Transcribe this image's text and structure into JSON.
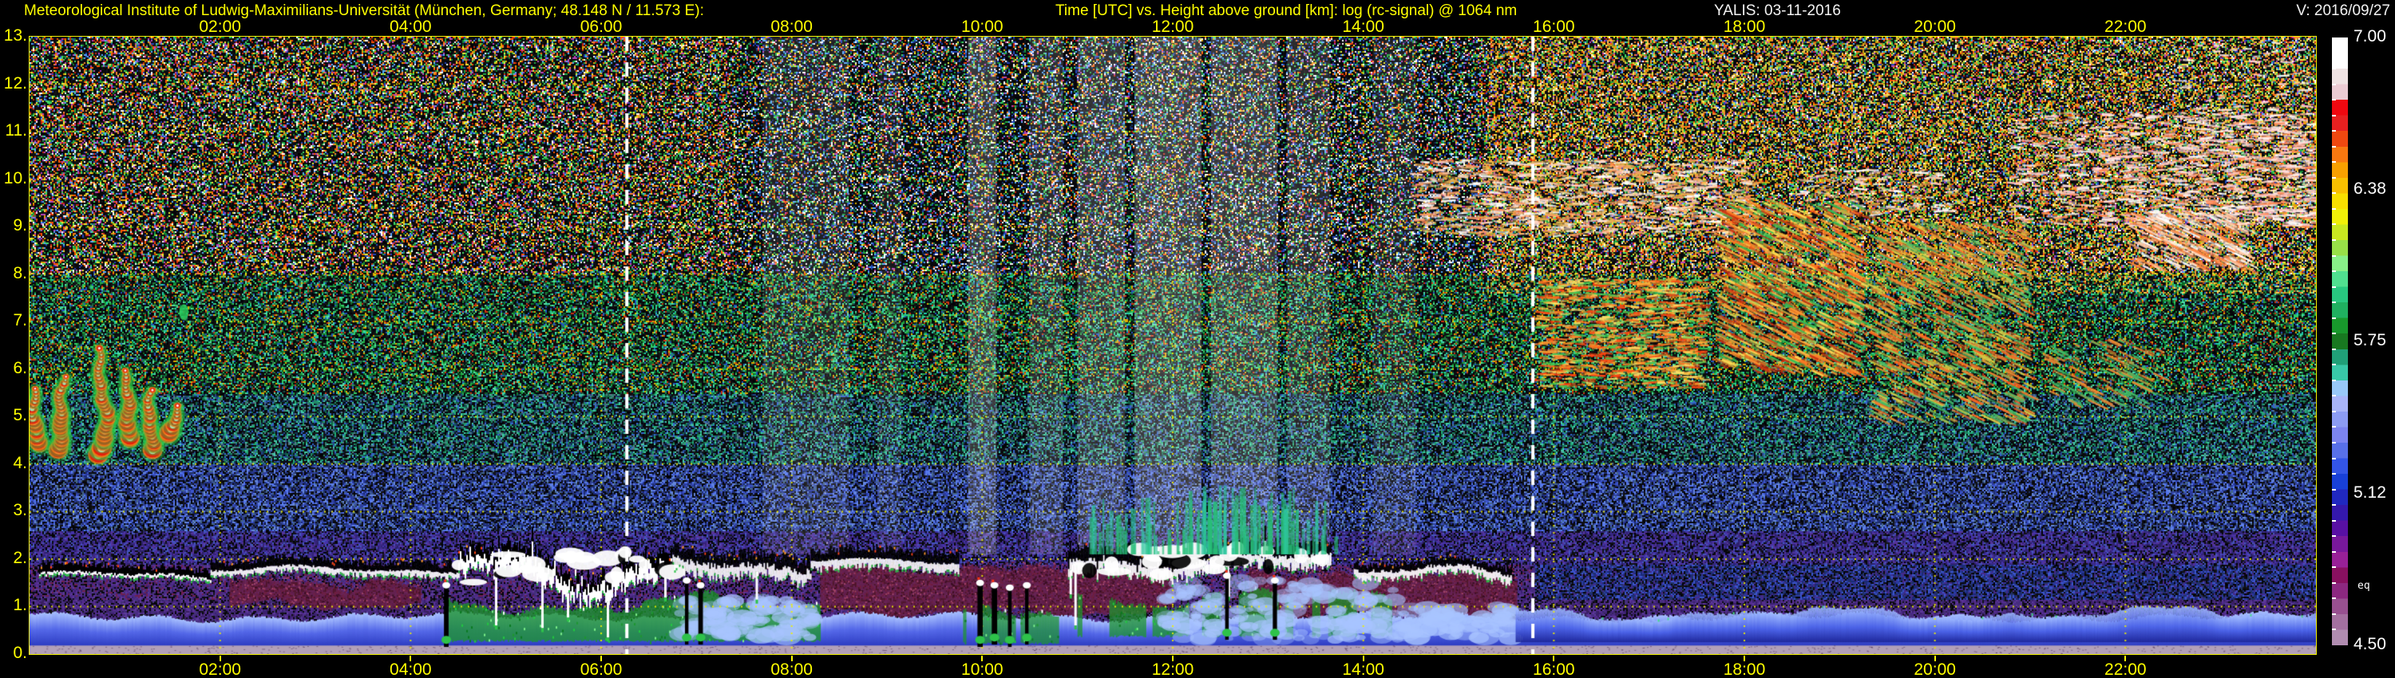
{
  "header": {
    "institute": "Meteorological Institute of Ludwig-Maximilians-Universität (München, Germany; 48.148 N / 11.573 E):",
    "plot_title": "Time [UTC] vs. Height above ground [km]: log (rc-signal) @ 1064 nm",
    "instrument_date": "YALIS: 03-11-2016",
    "version": "V: 2016/09/27"
  },
  "chart_data": {
    "type": "heatmap",
    "title": "Time [UTC] vs. Height above ground [km]: log (rc-signal) @ 1064 nm",
    "xlabel": "Time [UTC]",
    "ylabel": "Height above ground [km]",
    "xlim_hours": [
      0,
      24
    ],
    "ylim_km": [
      0,
      13
    ],
    "grid": {
      "on": true,
      "color": "#e8e800",
      "style": "dotted",
      "h_spacing_km": 1,
      "v_spacing_hours": 2
    },
    "x_tick_hours": [
      2,
      4,
      6,
      8,
      10,
      12,
      14,
      16,
      18,
      20,
      22
    ],
    "x_ticks": [
      "02:00",
      "04:00",
      "06:00",
      "08:00",
      "10:00",
      "12:00",
      "14:00",
      "16:00",
      "18:00",
      "20:00",
      "22:00"
    ],
    "y_ticks": [
      "13.",
      "12.",
      "11.",
      "10.",
      "9.",
      "8.",
      "7.",
      "6.",
      "5.",
      "4.",
      "3.",
      "2.",
      "1.",
      "0."
    ],
    "colorbar": {
      "values": [
        "7.00",
        "6.38",
        "5.75",
        "5.12",
        "4.50"
      ],
      "min": 4.5,
      "max": 7.0,
      "side_label": "eq",
      "colors": [
        "#ffffff",
        "#ffffff",
        "#f0e4e4",
        "#ecccd4",
        "#f00810",
        "#e82020",
        "#f04810",
        "#f87810",
        "#f8a000",
        "#f8c000",
        "#f8e000",
        "#f0f008",
        "#c8e820",
        "#98e048",
        "#88f088",
        "#50e090",
        "#28c880",
        "#20b060",
        "#18982c",
        "#187820",
        "#20a078",
        "#38c8a8",
        "#98c8f8",
        "#a8b4f8",
        "#8c9cf4",
        "#7c84f0",
        "#5870e8",
        "#3355e6",
        "#1840d8",
        "#2028c0",
        "#3418ac",
        "#5810a4",
        "#78189c",
        "#982098",
        "#881060",
        "#8c2880",
        "#985090",
        "#a470a0",
        "#b08cb0"
      ]
    },
    "marker_lines_utc": [
      6.27,
      15.78
    ],
    "noise": {
      "bands": [
        {
          "h": [
            8,
            13.01
          ],
          "black": 0.52,
          "colors": [
            "#cc2211",
            "#ff5500",
            "#ddaa00",
            "#eeee33",
            "#22aa44",
            "#44dd66",
            "#2244bb",
            "#55aaff",
            "#ffffff",
            "#bb44bb",
            "#ff8833",
            "#118833"
          ]
        },
        {
          "h": [
            5.5,
            8
          ],
          "black": 0.47,
          "colors": [
            "#118833",
            "#22aa44",
            "#33cc66",
            "#0a6622",
            "#22ccaa",
            "#115544",
            "#ddaa00",
            "#cc3311",
            "#2255bb",
            "#55ddaa",
            "#336644"
          ]
        },
        {
          "h": [
            4,
            5.5
          ],
          "black": 0.42,
          "colors": [
            "#116644",
            "#228866",
            "#22aa77",
            "#224488",
            "#3366cc",
            "#113355",
            "#44ccaa",
            "#557788"
          ]
        },
        {
          "h": [
            2.6,
            4
          ],
          "black": 0.34,
          "colors": [
            "#1a2a77",
            "#2a3aa0",
            "#3c55cc",
            "#5577ee",
            "#223366",
            "#334499",
            "#446688",
            "#6688dd"
          ]
        },
        {
          "h": [
            1.9,
            2.6
          ],
          "black": 0.3,
          "colors": [
            "#2a2266",
            "#3a2a88",
            "#4433aa",
            "#332277",
            "#4455bb",
            "#553399"
          ]
        },
        {
          "h": [
            1.15,
            1.9
          ],
          "t": [
            0,
            15.8
          ],
          "black": 0.26,
          "colors": [
            "#3a2070",
            "#4a2a85",
            "#552d90",
            "#6e2050",
            "#5c3a9a",
            "#44307a"
          ]
        },
        {
          "h": [
            1.15,
            1.9
          ],
          "black": 0.3,
          "colors": [
            "#1a2a77",
            "#2a3aa0",
            "#223366",
            "#3c55cc",
            "#442a88"
          ]
        },
        {
          "h": [
            0,
            1.15
          ],
          "black": 0.25,
          "colors": [
            "#3a2070",
            "#4a2a85",
            "#552d90",
            "#3a1f60",
            "#5c3a9a",
            "#44307a"
          ]
        }
      ],
      "evening": {
        "t_start": 15.3,
        "h_min": 7.6,
        "boost": 0.2,
        "colors": [
          "#ccaa22",
          "#ffcc44",
          "#ff8833",
          "#aa8822",
          "#eedd66",
          "#88aa22"
        ]
      },
      "day": {
        "t": [
          7.4,
          15.2
        ],
        "cool_prob": 0.45,
        "colors": [
          "#2244bb",
          "#55aaff",
          "#22aa44",
          "#0a0a10",
          "#ffffff",
          "#113366"
        ]
      },
      "day_columns": [
        {
          "t": [
            7.7,
            8.6
          ],
          "alpha": 0.1
        },
        {
          "t": [
            8.9,
            9.15
          ],
          "alpha": 0.08
        },
        {
          "t": [
            9.85,
            10.15
          ],
          "alpha": 0.2
        },
        {
          "t": [
            10.5,
            10.85
          ],
          "alpha": 0.14
        },
        {
          "t": [
            11.0,
            11.5
          ],
          "alpha": 0.18
        },
        {
          "t": [
            11.6,
            12.3
          ],
          "alpha": 0.22
        },
        {
          "t": [
            12.4,
            13.1
          ],
          "alpha": 0.2
        },
        {
          "t": [
            13.2,
            13.65
          ],
          "alpha": 0.14
        },
        {
          "t": [
            14.1,
            14.55
          ],
          "alpha": 0.09
        }
      ]
    },
    "features": {
      "surface_band": {
        "h": [
          0,
          0.18
        ],
        "color": "#b2a0b8"
      },
      "blue_surface_layer": {
        "h": [
          0.16,
          0.78
        ],
        "colors": [
          "#a8c0ff",
          "#5468e8",
          "#2b3ac0"
        ]
      },
      "maroon_patches": [
        {
          "t": [
            2.1,
            4.1
          ],
          "h": [
            1.0,
            1.65
          ]
        },
        {
          "t": [
            8.3,
            12.0
          ],
          "h": [
            0.85,
            1.95
          ]
        },
        {
          "t": [
            12.8,
            15.6
          ],
          "h": [
            0.8,
            1.85
          ]
        }
      ],
      "maroon_colors": [
        "#6e2040",
        "#3a0f22",
        "#a04468"
      ],
      "green_layers": [
        {
          "t": [
            4.4,
            8.3
          ],
          "h": [
            0.25,
            1.05
          ],
          "patchy": false
        },
        {
          "t": [
            9.8,
            10.9
          ],
          "h": [
            0.2,
            0.8
          ],
          "patchy": true
        },
        {
          "t": [
            10.9,
            14.3
          ],
          "h": [
            0.35,
            1.2
          ],
          "patchy": true
        }
      ],
      "green_colors": [
        "#1e9630",
        "#7df08a",
        "#0a7a20",
        "#22c840"
      ],
      "bl_segments": [
        {
          "t": [
            0.1,
            1.9
          ],
          "km": 1.65,
          "amp": 0.08,
          "white": 0.05,
          "black": 0.14,
          "messy": false,
          "hang": 0
        },
        {
          "t": [
            1.9,
            4.5
          ],
          "km": 1.78,
          "amp": 0.06,
          "white": 0.1,
          "black": 0.16,
          "messy": false,
          "hang": 0
        },
        {
          "t": [
            4.5,
            6.75
          ],
          "km": 1.85,
          "amp": 0.35,
          "white": 0.24,
          "black": 0.2,
          "messy": true,
          "hang": 0.03
        },
        {
          "t": [
            6.75,
            8.2
          ],
          "km": 1.95,
          "amp": 0.18,
          "white": 0.2,
          "black": 0.22,
          "messy": false,
          "hang": 0.035
        },
        {
          "t": [
            8.2,
            9.75
          ],
          "km": 1.95,
          "amp": 0.05,
          "white": 0.16,
          "black": 0.2,
          "messy": false,
          "hang": 0
        },
        {
          "t": [
            10.9,
            13.65
          ],
          "km": 1.98,
          "amp": 0.12,
          "white": 0.22,
          "black": 0.26,
          "messy": true,
          "hang": 0.02
        },
        {
          "t": [
            13.9,
            15.55
          ],
          "km": 1.72,
          "amp": 0.12,
          "white": 0.14,
          "black": 0.14,
          "messy": false,
          "hang": 0.01
        }
      ],
      "green_plumes": [
        {
          "t": [
            11.1,
            13.7
          ],
          "h": [
            2.1,
            3.3
          ],
          "count": 90
        },
        {
          "t": [
            12.1,
            13.5
          ],
          "h": [
            2.1,
            3.6
          ],
          "count": 50
        }
      ],
      "spikes": [
        {
          "t": 4.35,
          "h": [
            0.15,
            1.5
          ]
        },
        {
          "t": 6.88,
          "h": [
            0.2,
            1.6
          ]
        },
        {
          "t": 7.02,
          "h": [
            0.2,
            1.5
          ]
        },
        {
          "t": 9.95,
          "h": [
            0.15,
            1.55
          ]
        },
        {
          "t": 10.1,
          "h": [
            0.2,
            1.5
          ]
        },
        {
          "t": 10.27,
          "h": [
            0.15,
            1.45
          ]
        },
        {
          "t": 10.45,
          "h": [
            0.2,
            1.5
          ]
        },
        {
          "t": 12.55,
          "h": [
            0.3,
            1.7
          ]
        },
        {
          "t": 13.05,
          "h": [
            0.3,
            1.6
          ]
        }
      ],
      "blue_clouds": [
        {
          "t": [
            6.8,
            8.25
          ],
          "h": [
            0.35,
            1.15
          ],
          "c": "#9fc0ff",
          "flat": false
        },
        {
          "t": [
            11.9,
            14.35
          ],
          "h": [
            0.3,
            1.55
          ],
          "c": "#a8c4ff",
          "flat": false
        },
        {
          "t": [
            14.35,
            15.6
          ],
          "h": [
            0.3,
            1.0
          ],
          "c": "#90b0f8",
          "flat": false
        },
        {
          "t": [
            15.6,
            24.0
          ],
          "h": [
            0.25,
            0.85
          ],
          "c": "#4a62e8",
          "flat": true
        }
      ],
      "flames": {
        "region": {
          "t": [
            0.0,
            1.65
          ],
          "h": [
            3.9,
            6.6
          ]
        },
        "cores": [
          [
            0.08,
            4.4,
            5.6
          ],
          [
            0.35,
            4.3,
            5.9
          ],
          [
            0.75,
            4.2,
            6.5
          ],
          [
            1.05,
            4.5,
            6.0
          ],
          [
            1.3,
            4.3,
            5.6
          ],
          [
            1.52,
            4.6,
            5.3
          ]
        ]
      },
      "green_blob": {
        "t": 1.62,
        "h": 7.2
      },
      "speckle_clouds": [
        {
          "t": [
            14.55,
            18.1
          ],
          "h": [
            8.8,
            10.4
          ],
          "density": 0.35,
          "diag": false,
          "grow": false,
          "colors": [
            "#ffffff",
            "#ffd8c8",
            "#ff9966",
            "#e8b050"
          ]
        },
        {
          "t": [
            18.6,
            20.2
          ],
          "h": [
            9.2,
            10.2
          ],
          "density": 0.18,
          "diag": false,
          "grow": false,
          "colors": [
            "#ffffff",
            "#ffd0c0",
            "#cc8844"
          ]
        },
        {
          "t": [
            20.8,
            24.0
          ],
          "h": [
            9.0,
            11.4
          ],
          "density": 0.5,
          "diag": false,
          "grow": true,
          "colors": [
            "#ffffff",
            "#ffc8c8",
            "#ff8855",
            "#ffe0e0"
          ]
        },
        {
          "t": [
            22.1,
            23.3
          ],
          "h": [
            8.1,
            9.3
          ],
          "density": 0.4,
          "diag": true,
          "grow": false,
          "colors": [
            "#ff8844",
            "#ffccaa",
            "#ffffff"
          ]
        },
        {
          "t": [
            22.5,
            24.0
          ],
          "h": [
            11.4,
            12.9
          ],
          "density": 0.08,
          "diag": false,
          "grow": true,
          "colors": [
            "#ffffff",
            "#ffd8d8"
          ]
        },
        {
          "t": [
            15.85,
            17.6
          ],
          "h": [
            5.6,
            7.9
          ],
          "density": 0.5,
          "diag": false,
          "grow": false,
          "colors": [
            "#ff7722",
            "#ffaa33",
            "#44cc55",
            "#ff4411",
            "#ffe066"
          ]
        },
        {
          "t": [
            17.75,
            19.25
          ],
          "h": [
            5.9,
            9.5
          ],
          "density": 0.45,
          "diag": true,
          "grow": false,
          "colors": [
            "#ff7722",
            "#ff9933",
            "#33bb55",
            "#cc3311",
            "#ffdd55"
          ]
        },
        {
          "t": [
            19.35,
            21.0
          ],
          "h": [
            4.9,
            9.1
          ],
          "density": 0.28,
          "diag": true,
          "grow": false,
          "colors": [
            "#ee8833",
            "#44bb66",
            "#ff6622",
            "#ddcc44"
          ]
        },
        {
          "t": [
            21.2,
            22.4
          ],
          "h": [
            5.2,
            6.6
          ],
          "density": 0.18,
          "diag": true,
          "grow": false,
          "colors": [
            "#ee8833",
            "#44bb66"
          ]
        }
      ]
    }
  }
}
